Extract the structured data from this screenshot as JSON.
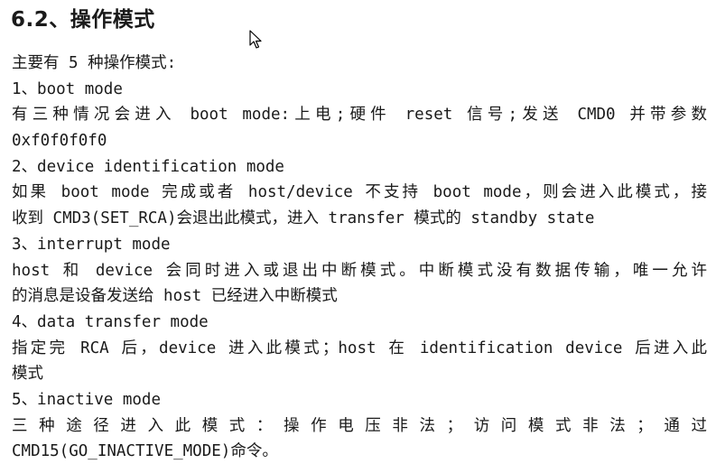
{
  "heading": "6.2、操作模式",
  "lines": [
    "主要有 5 种操作模式:",
    "1、boot mode",
    "有三种情况会进入 boot mode:上电;硬件 reset 信号;发送 CMD0 并带参数",
    "0xf0f0f0f0",
    "2、device identification mode",
    "如果 boot mode 完成或者 host/device 不支持 boot mode，则会进入此模式，接",
    "收到 CMD3(SET_RCA)会退出此模式，进入 transfer 模式的 standby state",
    "3、interrupt mode",
    "host 和 device 会同时进入或退出中断模式。中断模式没有数据传输，唯一允许",
    "的消息是设备发送给 host 已经进入中断模式",
    "4、data transfer mode",
    "指定完 RCA 后，device 进入此模式；host 在 identification device 后进入此",
    "模式",
    "5、inactive mode",
    "三种途径进入此模式：操作电压非法；访问模式非法；通过",
    "CMD15(GO_INACTIVE_MODE)命令。"
  ],
  "cursor_icon": "mouse-pointer-icon"
}
